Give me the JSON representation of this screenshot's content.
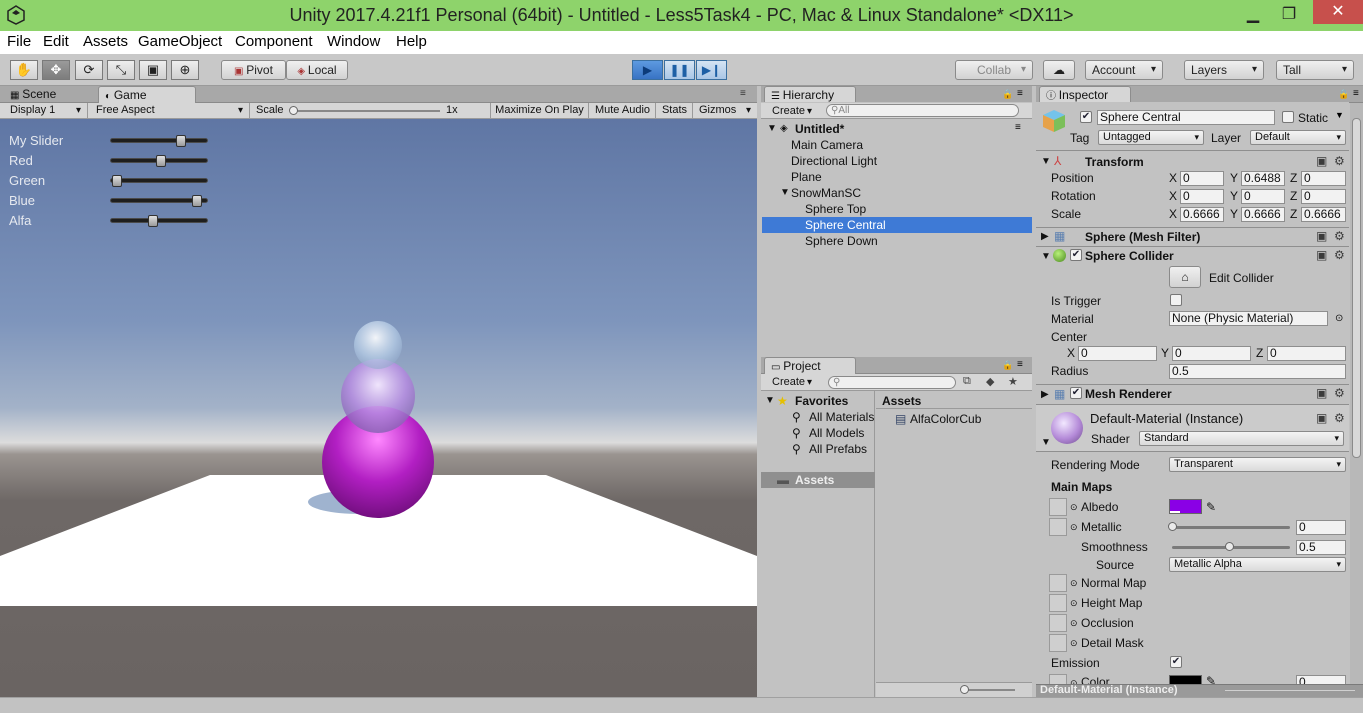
{
  "window": {
    "title": "Unity 2017.4.21f1 Personal (64bit) - Untitled - Less5Task4 - PC, Mac & Linux Standalone* <DX11>",
    "minimize": "▁",
    "maximize": "❐",
    "close": "✕"
  },
  "menu": [
    "File",
    "Edit",
    "Assets",
    "GameObject",
    "Component",
    "Window",
    "Help"
  ],
  "toolbar": {
    "pivot": "Pivot",
    "local": "Local",
    "collab": "Collab",
    "account": "Account",
    "layers": "Layers",
    "layout": "Tall",
    "play_state": "playing"
  },
  "scene_tabs": {
    "scene": "Scene",
    "game": "Game"
  },
  "game_toolbar": {
    "display": "Display 1",
    "aspect": "Free Aspect",
    "scale_label": "Scale",
    "scale_value": "1x",
    "maximize_on_play": "Maximize On Play",
    "mute_audio": "Mute Audio",
    "stats": "Stats",
    "gizmos": "Gizmos"
  },
  "game_ui": {
    "sliders": [
      {
        "label": "My Slider",
        "value": 0.75
      },
      {
        "label": "Red",
        "value": 0.52
      },
      {
        "label": "Green",
        "value": 0.02
      },
      {
        "label": "Blue",
        "value": 0.93
      },
      {
        "label": "Alfa",
        "value": 0.43
      }
    ]
  },
  "hierarchy": {
    "tab": "Hierarchy",
    "create": "Create",
    "search_placeholder": "All",
    "scene": "Untitled*",
    "items": [
      "Main Camera",
      "Directional Light",
      "Plane",
      "SnowManSC"
    ],
    "children": [
      "Sphere Top",
      "Sphere Central",
      "Sphere Down"
    ],
    "selected": "Sphere Central"
  },
  "project": {
    "tab": "Project",
    "create": "Create",
    "favorites": "Favorites",
    "favorite_items": [
      "All Materials",
      "All Models",
      "All Prefabs"
    ],
    "assets_root": "Assets",
    "assets_header": "Assets",
    "asset_items": [
      "AlfaColorCub"
    ]
  },
  "inspector": {
    "tab": "Inspector",
    "object_name": "Sphere Central",
    "static_label": "Static",
    "tag_label": "Tag",
    "tag_value": "Untagged",
    "layer_label": "Layer",
    "layer_value": "Default",
    "transform": {
      "title": "Transform",
      "position_label": "Position",
      "rotation_label": "Rotation",
      "scale_label": "Scale",
      "position": {
        "x": "0",
        "y": "0.6488",
        "z": "0"
      },
      "rotation": {
        "x": "0",
        "y": "0",
        "z": "0"
      },
      "scale": {
        "x": "0.6666",
        "y": "0.6666",
        "z": "0.6666"
      }
    },
    "mesh_filter": "Sphere (Mesh Filter)",
    "sphere_collider": {
      "title": "Sphere Collider",
      "edit_collider": "Edit Collider",
      "is_trigger": "Is Trigger",
      "material_label": "Material",
      "material_value": "None (Physic Material)",
      "center_label": "Center",
      "center": {
        "x": "0",
        "y": "0",
        "z": "0"
      },
      "radius_label": "Radius",
      "radius": "0.5"
    },
    "mesh_renderer": "Mesh Renderer",
    "material": {
      "name": "Default-Material (Instance)",
      "shader_label": "Shader",
      "shader_value": "Standard",
      "rendering_mode_label": "Rendering Mode",
      "rendering_mode_value": "Transparent",
      "main_maps": "Main Maps",
      "albedo": "Albedo",
      "albedo_color": "#8a00e6",
      "metallic": "Metallic",
      "metallic_value": "0",
      "smoothness": "Smoothness",
      "smoothness_value": "0.5",
      "source_label": "Source",
      "source_value": "Metallic Alpha",
      "normal_map": "Normal Map",
      "height_map": "Height Map",
      "occlusion": "Occlusion",
      "detail_mask": "Detail Mask",
      "emission": "Emission",
      "color": "Color",
      "color_value": "0"
    },
    "footer": "Default-Material (Instance)"
  },
  "coords": {
    "x": "X",
    "y": "Y",
    "z": "Z"
  }
}
